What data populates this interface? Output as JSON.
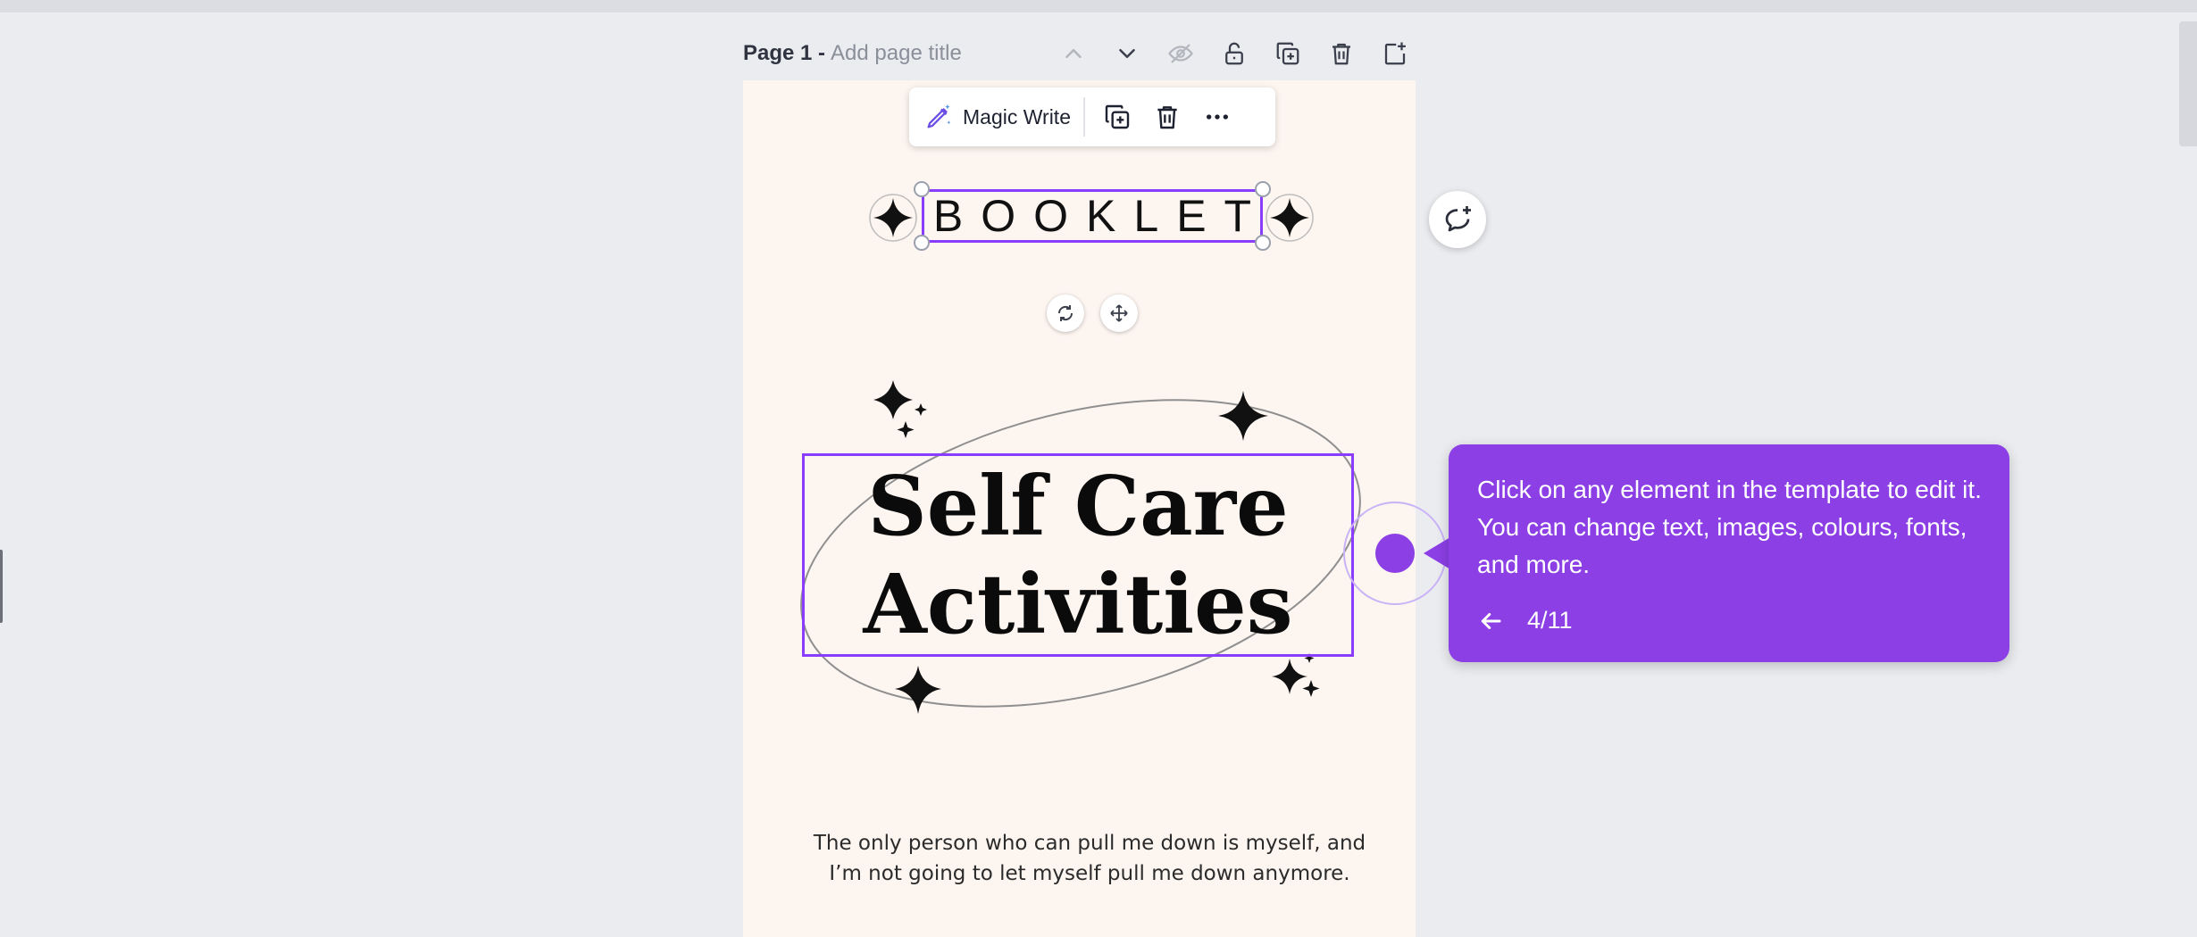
{
  "page_header": {
    "label": "Page 1 -",
    "title_placeholder": "Add page title",
    "tools": [
      "chevron-up-icon",
      "chevron-down-icon",
      "hide-icon",
      "lock-icon",
      "duplicate-page-icon",
      "delete-page-icon",
      "add-page-icon"
    ]
  },
  "toolbar": {
    "magic_write_label": "Magic Write",
    "buttons": [
      "duplicate-icon",
      "trash-icon",
      "more-icon"
    ]
  },
  "design": {
    "booklet_text": "BOOKLET",
    "title_line1": "Self Care",
    "title_line2": "Activities",
    "quote_line1": "The only person who can pull me down is myself, and",
    "quote_line2": "I’m not going to let myself pull me down anymore."
  },
  "tooltip": {
    "text": "Click on any element in the template to edit it. You can change text, images, colours, fonts, and more.",
    "step": "4/11"
  },
  "colors": {
    "accent": "#8b3dff",
    "tooltip_bg": "#8b3fe4",
    "page_bg": "#fdf5f0",
    "workspace_bg": "#ebecf0"
  }
}
